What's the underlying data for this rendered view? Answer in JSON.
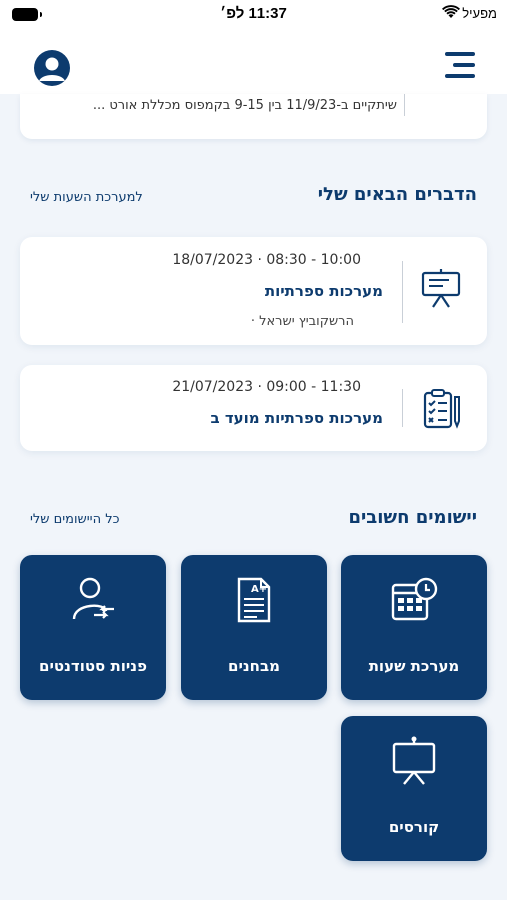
{
  "status_bar": {
    "time": "11:37 לפ׳",
    "carrier": "מפעיל"
  },
  "header": {
    "profile_icon": "user-circle-icon",
    "menu_icon": "hamburger-menu-icon"
  },
  "banner": {
    "text": "שיתקיים ב-11/9/23 בין 9-15 בקמפוס מכללת אורט ..."
  },
  "upcoming": {
    "title": "הדברים הבאים שלי",
    "link": "למערכת השעות שלי",
    "events": [
      {
        "icon": "presentation-board-icon",
        "time": "18/07/2023 · 08:30 - 10:00",
        "title": "מערכות ספרתיות",
        "lecturer": "הרשקוביץ ישראל ·"
      },
      {
        "icon": "clipboard-checklist-icon",
        "time": "21/07/2023 · 09:00 - 11:30",
        "title": "מערכות ספרתיות מועד ב"
      }
    ]
  },
  "apps": {
    "title": "יישומים חשובים",
    "link": "כל היישומים שלי",
    "tiles": [
      {
        "label": "מערכת שעות",
        "icon": "calendar-clock-icon"
      },
      {
        "label": "מבחנים",
        "icon": "graded-exam-icon"
      },
      {
        "label": "פניות סטודנטים",
        "icon": "student-request-icon"
      },
      {
        "label": "קורסים",
        "icon": "presentation-board-icon"
      }
    ]
  },
  "colors": {
    "brand": "#0d3b6e",
    "background": "#f1f5fa",
    "card": "#ffffff"
  }
}
